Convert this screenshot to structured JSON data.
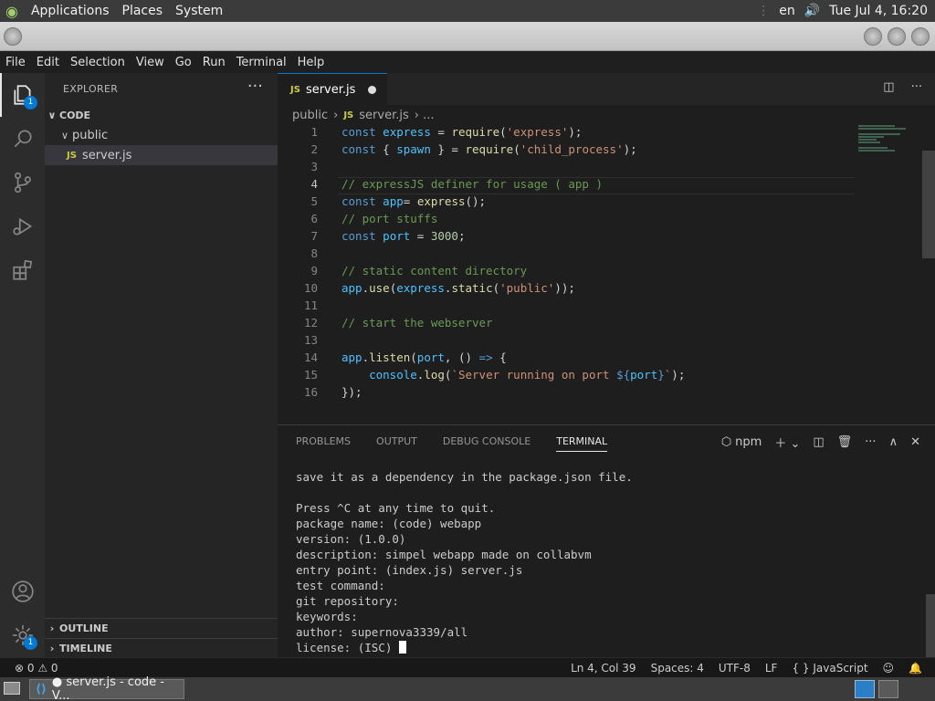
{
  "top_panel": {
    "menus": [
      "Applications",
      "Places",
      "System"
    ],
    "lang": "en",
    "datetime": "Tue Jul  4, 16:20"
  },
  "menubar": [
    "File",
    "Edit",
    "Selection",
    "View",
    "Go",
    "Run",
    "Terminal",
    "Help"
  ],
  "activity": {
    "explorer_badge": "1",
    "settings_badge": "1"
  },
  "sidebar": {
    "title": "EXPLORER",
    "more": "···",
    "root": "CODE",
    "folder": "public",
    "file": "server.js",
    "file_icon": "JS",
    "outline": "OUTLINE",
    "timeline": "TIMELINE"
  },
  "tab": {
    "icon": "JS",
    "name": "server.js"
  },
  "breadcrumb": {
    "folder": "public",
    "sep": "›",
    "icon": "JS",
    "file": "server.js",
    "tail": "› ..."
  },
  "code_lines": [
    "1",
    "2",
    "3",
    "4",
    "5",
    "6",
    "7",
    "8",
    "9",
    "10",
    "11",
    "12",
    "13",
    "14",
    "15",
    "16"
  ],
  "panel": {
    "tabs": [
      "PROBLEMS",
      "OUTPUT",
      "DEBUG CONSOLE",
      "TERMINAL"
    ],
    "active_tab": "TERMINAL",
    "shell": "npm",
    "terminal_lines": [
      "save it as a dependency in the package.json file.",
      "",
      "Press ^C at any time to quit.",
      "package name: (code) webapp",
      "version: (1.0.0)",
      "description: simpel webapp made on collabvm",
      "entry point: (index.js) server.js",
      "test command:",
      "git repository:",
      "keywords:",
      "author: supernova3339/all",
      "license: (ISC) "
    ]
  },
  "statusbar": {
    "problems": "⊗ 0 ⚠ 0",
    "position": "Ln 4, Col 39",
    "spaces": "Spaces: 4",
    "encoding": "UTF-8",
    "eol": "LF",
    "language": "{ } JavaScript"
  },
  "taskbar": {
    "window": "● server.js - code - V..."
  }
}
